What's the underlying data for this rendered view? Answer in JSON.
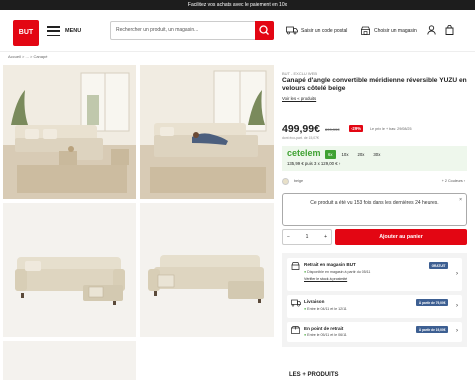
{
  "topbar": {
    "text": "Facilitez vos achats avec le paiement en 10x"
  },
  "header": {
    "logo": "BUT",
    "menu_label": "MENU",
    "search_placeholder": "Rechercher un produit, un magasin...",
    "postal_label": "Saisir un code postal",
    "store_label": "Choisir un magasin",
    "icons": [
      "truck-icon",
      "store-icon",
      "user-icon",
      "bag-icon"
    ]
  },
  "breadcrumb": {
    "home": "Accueil",
    "sep": ">",
    "ellipsis": "...",
    "current": "Canapé"
  },
  "product": {
    "brand": "BUT - EXCLU WEB",
    "title": "Canapé d'angle convertible méridienne réversible YUZU en velours côtelé beige",
    "reviews_link": "Voir les « produits",
    "price": "499,99€",
    "old_price": "699,99€",
    "discount": "-29%",
    "price_ref": "Le prix le + bas: 29/08/25",
    "eco_part": "dont éco-part. de 15,07€"
  },
  "credit": {
    "brand": "cetelem",
    "terms": [
      "6x",
      "10x",
      "20x",
      "30x"
    ],
    "active_term": "6x",
    "line": "135,99 € puis 3 x 129,00 € ›"
  },
  "color": {
    "label": "beige",
    "more": "+ 2 Couleurs ›"
  },
  "notice": {
    "text": "Ce produit a été vu 153 fois dans les dernières 24 heures.",
    "close": "×"
  },
  "cart": {
    "minus": "−",
    "qty": "1",
    "plus": "+",
    "add_label": "Ajouter au panier"
  },
  "delivery": [
    {
      "title": "Retrait en magasin BUT",
      "sub": "Disponible en magasin à partir du 05/11",
      "link": "Vérifier le stock à proximité",
      "badge": "GRATUIT"
    },
    {
      "title": "Livraison",
      "sub": "Entre le 04/11 et le 12/11",
      "link": "",
      "badge": "À partir de 79,00€"
    },
    {
      "title": "En point de retrait",
      "sub": "Entre le 05/11 et le 06/11",
      "link": "",
      "badge": "À partir de 19,00€"
    }
  ],
  "section_title": "LES + PRODUITS",
  "colors": {
    "brand_red": "#e30613",
    "credit_green": "#3fa132",
    "badge_blue": "#3d5f92"
  }
}
